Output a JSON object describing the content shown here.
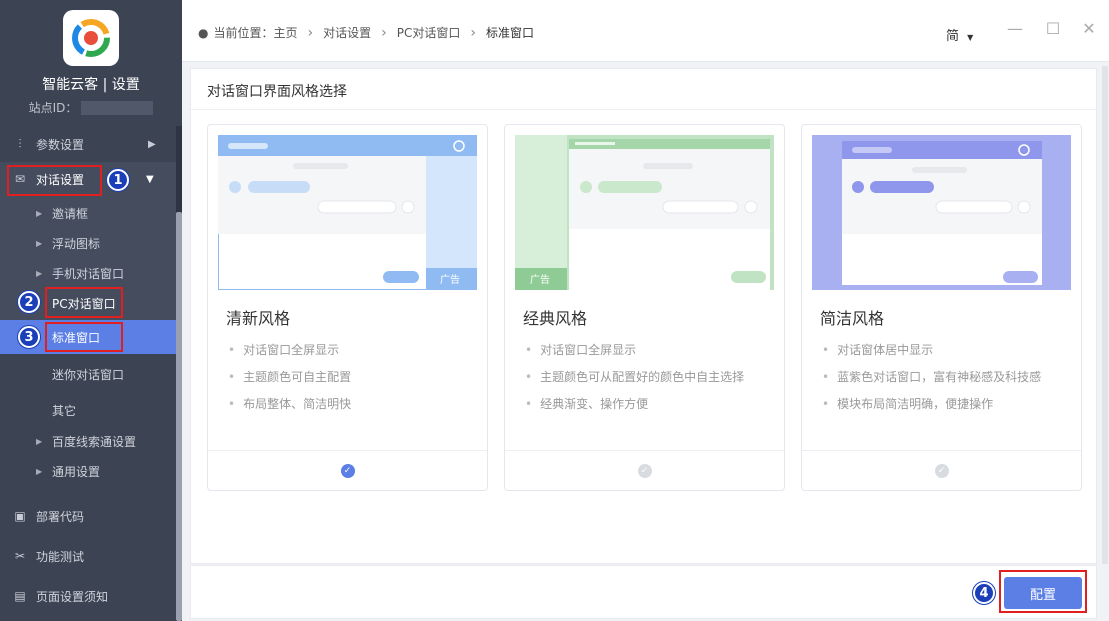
{
  "app": {
    "name": "智能云客 | 设置",
    "site_id_label": "站点ID："
  },
  "sidebar": {
    "params": "参数设置",
    "dialog": "对话设置",
    "sub": [
      "邀请框",
      "浮动图标",
      "手机对话窗口",
      "PC对话窗口",
      "标准窗口",
      "迷你对话窗口",
      "其它",
      "百度线索通设置",
      "通用设置"
    ],
    "deploy": "部署代码",
    "test": "功能测试",
    "notice": "页面设置须知"
  },
  "steps": [
    "1",
    "2",
    "3",
    "4"
  ],
  "breadcrumb": {
    "label": "当前位置：主页",
    "items": [
      "对话设置",
      "PC对话窗口",
      "标准窗口"
    ]
  },
  "lang": "简",
  "panel_title": "对话窗口界面风格选择",
  "cards": [
    {
      "title": "清新风格",
      "features": [
        "对话窗口全屏显示",
        "主题颜色可自主配置",
        "布局整体、简洁明快"
      ],
      "ad": "广告",
      "selected": true
    },
    {
      "title": "经典风格",
      "features": [
        "对话窗口全屏显示",
        "主题颜色可从配置好的颜色中自主选择",
        "经典渐变、操作方便"
      ],
      "ad": "广告",
      "selected": false
    },
    {
      "title": "简洁风格",
      "features": [
        "对话窗体居中显示",
        "蓝紫色对话窗口，富有神秘感及科技感",
        "模块布局简洁明确，便捷操作"
      ],
      "selected": false
    }
  ],
  "config_button": "配置",
  "colors": {
    "sidebar": "#3c4353",
    "accent": "#5c7fe6",
    "fresh": "#8fbbf2",
    "classic": "#bfe3c3",
    "simple": "#a9b0f2",
    "marker": "#e02020"
  }
}
